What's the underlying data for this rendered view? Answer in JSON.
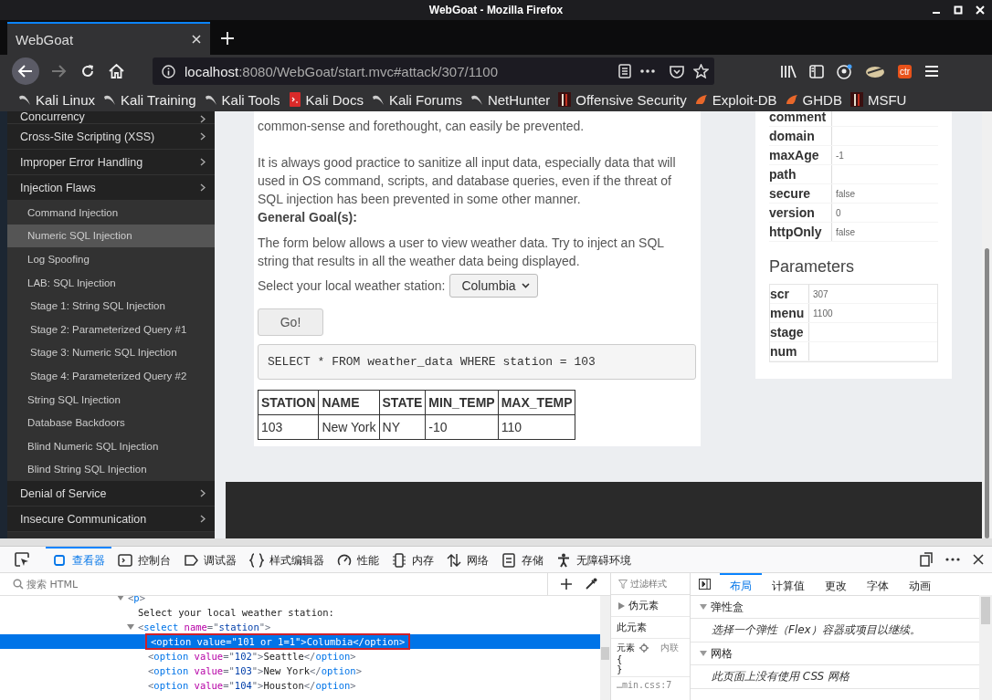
{
  "window": {
    "title": "WebGoat - Mozilla Firefox"
  },
  "tabs": [
    {
      "label": "WebGoat",
      "selected": true
    }
  ],
  "address": {
    "host": "localhost",
    "path": ":8080/WebGoat/start.mvc#attack/307/1100"
  },
  "extension_badge": "ctr",
  "bookmarks": [
    {
      "label": "Kali Linux",
      "kind": "dragon"
    },
    {
      "label": "Kali Training",
      "kind": "dragon"
    },
    {
      "label": "Kali Tools",
      "kind": "dragon"
    },
    {
      "label": "Kali Docs",
      "kind": "docs"
    },
    {
      "label": "Kali Forums",
      "kind": "dragon"
    },
    {
      "label": "NetHunter",
      "kind": "dragon"
    },
    {
      "label": "Offensive Security",
      "kind": "tower"
    },
    {
      "label": "Exploit-DB",
      "kind": "flame"
    },
    {
      "label": "GHDB",
      "kind": "flame"
    },
    {
      "label": "MSFU",
      "kind": "tower"
    }
  ],
  "sidebar": [
    {
      "label": "Concurrency"
    },
    {
      "label": "Cross-Site Scripting (XSS)"
    },
    {
      "label": "Improper Error Handling"
    },
    {
      "label": "Injection Flaws",
      "children": [
        {
          "label": "Command Injection",
          "selected": false
        },
        {
          "label": "Numeric SQL Injection",
          "selected": true
        },
        {
          "label": "Log Spoofing",
          "selected": false
        },
        {
          "label": "LAB: SQL Injection",
          "selected": false,
          "children": [
            {
              "label": "Stage 1: String SQL Injection",
              "selected": false
            },
            {
              "label": "Stage 2: Parameterized Query #1",
              "selected": false
            },
            {
              "label": "Stage 3: Numeric SQL Injection",
              "selected": false
            },
            {
              "label": "Stage 4: Parameterized Query #2",
              "selected": false
            }
          ]
        },
        {
          "label": "String SQL Injection",
          "selected": false
        },
        {
          "label": "Database Backdoors",
          "selected": false
        },
        {
          "label": "Blind Numeric SQL Injection",
          "selected": false
        },
        {
          "label": "Blind String SQL Injection",
          "selected": false
        }
      ]
    },
    {
      "label": "Denial of Service"
    },
    {
      "label": "Insecure Communication"
    }
  ],
  "lesson": {
    "paragraphs": [
      "common-sense and forethought, can easily be prevented.",
      "It is always good practice to sanitize all input data, especially data that will used in OS command, scripts, and database queries, even if the threat of SQL injection has been prevented in some other manner."
    ],
    "goal_heading": "General Goal(s):",
    "goal_text": "The form below allows a user to view weather data. Try to inject an SQL string that results in all the weather data being displayed.",
    "station_label": "Select your local weather station:",
    "station_value": "Columbia",
    "go_button": "Go!",
    "query": "SELECT * FROM weather_data WHERE station = 103",
    "table": {
      "columns": [
        "STATION",
        "NAME",
        "STATE",
        "MIN_TEMP",
        "MAX_TEMP"
      ],
      "rows": [
        [
          "103",
          "New York",
          "NY",
          "-10",
          "110"
        ]
      ]
    }
  },
  "cookie": [
    {
      "key": "comment"
    },
    {
      "key": "domain"
    },
    {
      "key": "maxAge",
      "value": "-1"
    },
    {
      "key": "path"
    },
    {
      "key": "secure",
      "value": "false"
    },
    {
      "key": "version",
      "value": "0"
    },
    {
      "key": "httpOnly",
      "value": "false"
    }
  ],
  "parameters": {
    "title": "Parameters",
    "rows": [
      {
        "key": "scr",
        "value": "307"
      },
      {
        "key": "menu",
        "value": "1100"
      },
      {
        "key": "stage"
      },
      {
        "key": "num"
      }
    ]
  },
  "devtools": {
    "tools": [
      {
        "label": "查看器",
        "kind": "inspector",
        "selected": true
      },
      {
        "label": "控制台",
        "kind": "console",
        "selected": false
      },
      {
        "label": "调试器",
        "kind": "debugger",
        "selected": false
      },
      {
        "label": "样式编辑器",
        "kind": "style",
        "selected": false
      },
      {
        "label": "性能",
        "kind": "perf",
        "selected": false
      },
      {
        "label": "内存",
        "kind": "memory",
        "selected": false
      },
      {
        "label": "网络",
        "kind": "network",
        "selected": false
      },
      {
        "label": "存储",
        "kind": "storage",
        "selected": false
      },
      {
        "label": "无障碍环境",
        "kind": "a11y",
        "selected": false
      }
    ],
    "search_placeholder": "搜索 HTML",
    "markup": [
      {
        "expanded": true,
        "segs": [
          {
            "kind": "punct",
            "text": "<"
          },
          {
            "kind": "tag",
            "text": "p"
          },
          {
            "kind": "punct",
            "text": ">"
          }
        ],
        "children": [
          {
            "segs": [
              {
                "kind": "text",
                "text": "Select your local weather station:"
              }
            ]
          },
          {
            "expanded": true,
            "segs": [
              {
                "kind": "punct",
                "text": "<"
              },
              {
                "kind": "tag",
                "text": "select"
              },
              {
                "kind": "attr",
                "text": "name"
              },
              {
                "kind": "punct",
                "text": "=\""
              },
              {
                "kind": "value",
                "text": "station"
              },
              {
                "kind": "punct",
                "text": "\">"
              }
            ],
            "children": [
              {
                "selected": true,
                "segs": [
                  {
                    "kind": "punct",
                    "text": "<"
                  },
                  {
                    "kind": "tag",
                    "text": "option"
                  },
                  {
                    "kind": "attr",
                    "text": "value"
                  },
                  {
                    "kind": "punct",
                    "text": "=\""
                  },
                  {
                    "kind": "value",
                    "text": "101 or 1=1"
                  },
                  {
                    "kind": "punct",
                    "text": "\">"
                  },
                  {
                    "kind": "text",
                    "text": "Columbia"
                  },
                  {
                    "kind": "punct",
                    "text": "</"
                  },
                  {
                    "kind": "tag",
                    "text": "option"
                  },
                  {
                    "kind": "punct",
                    "text": ">"
                  }
                ]
              },
              {
                "selected": false,
                "segs": [
                  {
                    "kind": "punct",
                    "text": "<"
                  },
                  {
                    "kind": "tag",
                    "text": "option"
                  },
                  {
                    "kind": "attr",
                    "text": "value"
                  },
                  {
                    "kind": "punct",
                    "text": "=\""
                  },
                  {
                    "kind": "value",
                    "text": "102"
                  },
                  {
                    "kind": "punct",
                    "text": "\">"
                  },
                  {
                    "kind": "text",
                    "text": "Seattle"
                  },
                  {
                    "kind": "punct",
                    "text": "</"
                  },
                  {
                    "kind": "tag",
                    "text": "option"
                  },
                  {
                    "kind": "punct",
                    "text": ">"
                  }
                ]
              },
              {
                "selected": false,
                "segs": [
                  {
                    "kind": "punct",
                    "text": "<"
                  },
                  {
                    "kind": "tag",
                    "text": "option"
                  },
                  {
                    "kind": "attr",
                    "text": "value"
                  },
                  {
                    "kind": "punct",
                    "text": "=\""
                  },
                  {
                    "kind": "value",
                    "text": "103"
                  },
                  {
                    "kind": "punct",
                    "text": "\">"
                  },
                  {
                    "kind": "text",
                    "text": "New York"
                  },
                  {
                    "kind": "punct",
                    "text": "</"
                  },
                  {
                    "kind": "tag",
                    "text": "option"
                  },
                  {
                    "kind": "punct",
                    "text": ">"
                  }
                ]
              },
              {
                "selected": false,
                "segs": [
                  {
                    "kind": "punct",
                    "text": "<"
                  },
                  {
                    "kind": "tag",
                    "text": "option"
                  },
                  {
                    "kind": "attr",
                    "text": "value"
                  },
                  {
                    "kind": "punct",
                    "text": "=\""
                  },
                  {
                    "kind": "value",
                    "text": "104"
                  },
                  {
                    "kind": "punct",
                    "text": "\">"
                  },
                  {
                    "kind": "text",
                    "text": "Houston"
                  },
                  {
                    "kind": "punct",
                    "text": "</"
                  },
                  {
                    "kind": "tag",
                    "text": "option"
                  },
                  {
                    "kind": "punct",
                    "text": ">"
                  }
                ]
              }
            ]
          }
        ]
      }
    ],
    "rules": {
      "filter_placeholder": "过滤样式",
      "pseudo": {
        "label": "伪元素",
        "expanded": false
      },
      "this_element": "此元素",
      "element_label": "元素",
      "inline_label": "内联",
      "open_brace": "{",
      "close_brace": "}",
      "source": "…min.css:7"
    },
    "layout_tabs": [
      {
        "label": "布局",
        "selected": true
      },
      {
        "label": "计算值",
        "selected": false
      },
      {
        "label": "更改",
        "selected": false
      },
      {
        "label": "字体",
        "selected": false
      },
      {
        "label": "动画",
        "selected": false
      }
    ],
    "layout_sections": [
      {
        "title": "弹性盒",
        "expanded": true,
        "note": "选择一个弹性（Flex）容器或项目以继续。"
      },
      {
        "title": "网格",
        "expanded": true,
        "note": "此页面上没有使用 CSS 网格"
      }
    ]
  }
}
